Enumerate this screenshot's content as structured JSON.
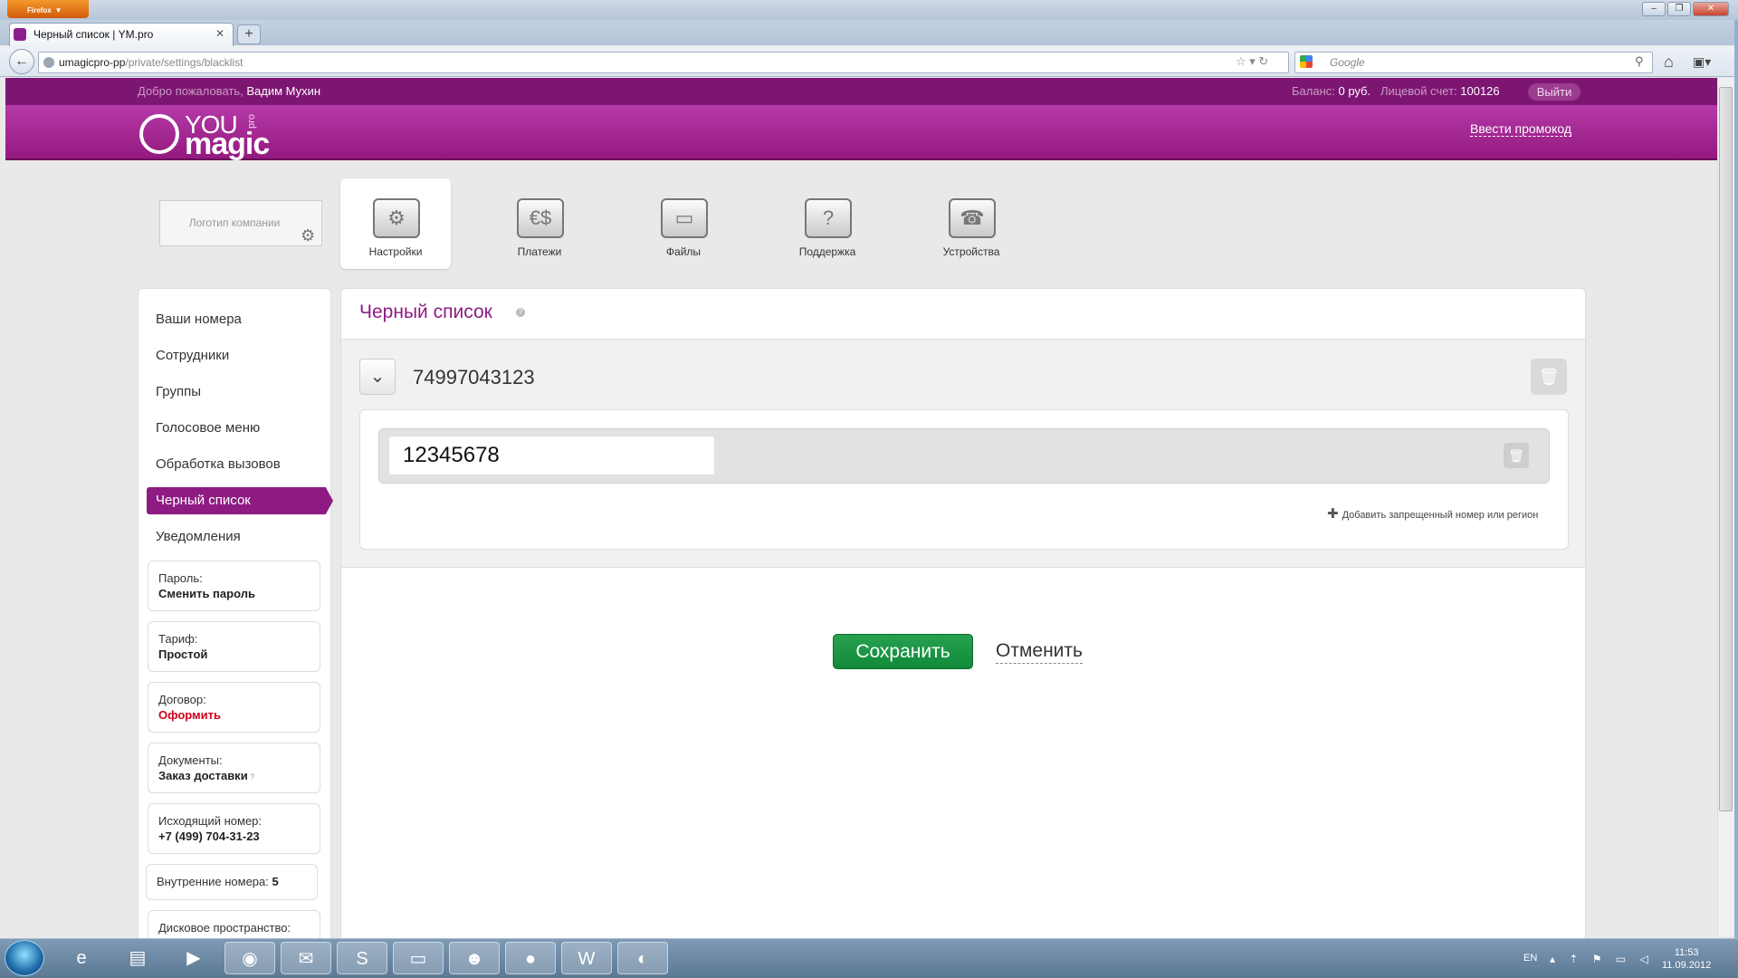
{
  "browser": {
    "app_button": "Firefox",
    "tab_title": "Черный список | YM.pro",
    "url_host": "umagicpro-pp",
    "url_path": "/private/settings/blacklist",
    "search_placeholder": "Google",
    "new_tab_symbol": "+"
  },
  "site": {
    "welcome_prefix": "Добро пожаловать, ",
    "user_name": "Вадим Мухин",
    "balance_label": "Баланс: ",
    "balance_value": "0 руб.",
    "account_label": "Лицевой счет: ",
    "account_value": "100126",
    "logout": "Выйти",
    "logo_you": "YOU",
    "logo_magic": "magic",
    "logo_pro": "pro",
    "promo_link": "Ввести промокод",
    "company_logo_placeholder": "Логотип компании"
  },
  "top_nav": [
    {
      "label": "Настройки",
      "icon": "settings-gears-icon",
      "active": true
    },
    {
      "label": "Платежи",
      "icon": "payments-icon"
    },
    {
      "label": "Файлы",
      "icon": "files-icon"
    },
    {
      "label": "Поддержка",
      "icon": "support-icon"
    },
    {
      "label": "Устройства",
      "icon": "devices-icon"
    }
  ],
  "sidebar": {
    "items": [
      "Ваши номера",
      "Сотрудники",
      "Группы",
      "Голосовое меню",
      "Обработка вызовов",
      "Черный список",
      "Уведомления"
    ],
    "active_index": 5,
    "boxes": [
      {
        "key": "Пароль:",
        "value": "Сменить пароль"
      },
      {
        "key": "Тариф:",
        "value": "Простой"
      },
      {
        "key": "Договор:",
        "value": "Оформить"
      },
      {
        "key": "Документы:",
        "value": "Заказ доставки"
      },
      {
        "key": "Исходящий номер:",
        "value": "+7 (499) 704-31-23"
      },
      {
        "key": "Внутренние номера:",
        "value": "5"
      },
      {
        "key": "Дисковое пространство:",
        "value": ""
      }
    ]
  },
  "main": {
    "title": "Черный список",
    "help": "?",
    "number": "74997043123",
    "blocked_entry": "12345678",
    "add_label": "Добавить запрещенный номер или регион",
    "save": "Сохранить",
    "cancel": "Отменить"
  },
  "taskbar": {
    "lang": "EN",
    "time": "11:53",
    "date": "11.09.2012"
  },
  "colors": {
    "brand": "#8e1b82",
    "save": "#1a9444",
    "contract_link": "#d0021b"
  }
}
